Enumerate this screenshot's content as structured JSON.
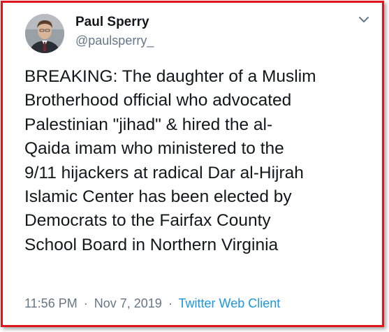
{
  "tweet": {
    "author_name": "Paul Sperry",
    "author_handle": "@paulsperry_",
    "text_lines": [
      "BREAKING: The daughter of a Muslim",
      "Brotherhood official who advocated",
      "Palestinian \"jihad\" & hired the al-",
      "Qaida imam who ministered to the",
      "9/11 hijackers at radical Dar al-Hijrah",
      "Islamic Center has been elected by",
      "Democrats to the Fairfax County",
      "School Board in Northern Virginia"
    ],
    "time": "11:56 PM",
    "separator": "·",
    "date": "Nov 7, 2019",
    "source": "Twitter Web Client"
  },
  "icons": {
    "menu": "chevron-down-icon",
    "avatar": "profile-photo"
  },
  "colors": {
    "frame_border": "#e1141c",
    "text": "#14171a",
    "secondary_text": "#657786",
    "link": "#1b95e0"
  }
}
